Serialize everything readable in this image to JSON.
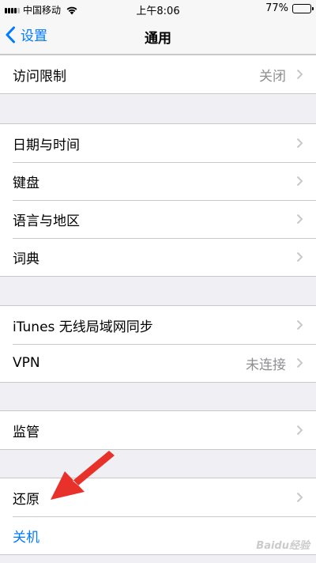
{
  "status_bar": {
    "carrier": "中国移动",
    "time": "上午8:06",
    "battery": "77%",
    "battery_level": 0.77
  },
  "nav": {
    "back_label": "设置",
    "title": "通用"
  },
  "groups": [
    {
      "rows": [
        {
          "label": "访问限制",
          "value": "关闭"
        }
      ]
    },
    {
      "rows": [
        {
          "label": "日期与时间"
        },
        {
          "label": "键盘"
        },
        {
          "label": "语言与地区"
        },
        {
          "label": "词典"
        }
      ]
    },
    {
      "rows": [
        {
          "label": "iTunes 无线局域网同步"
        },
        {
          "label": "VPN",
          "value": "未连接"
        }
      ]
    },
    {
      "rows": [
        {
          "label": "监管"
        }
      ]
    },
    {
      "rows": [
        {
          "label": "还原"
        },
        {
          "label": "关机"
        }
      ]
    }
  ],
  "colors": {
    "accent": "#007aff",
    "annotation": "#e8312a",
    "background": "#efeff4"
  },
  "watermark": "Baidu经验"
}
